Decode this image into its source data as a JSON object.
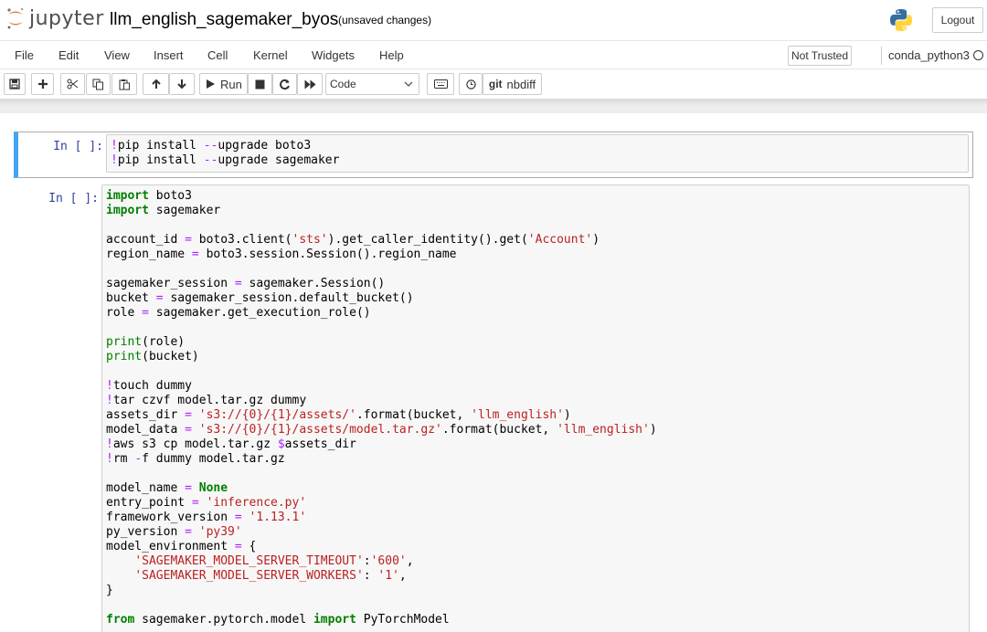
{
  "header": {
    "logo_text": "jupyter",
    "notebook_title": "llm_english_sagemaker_byos",
    "autosave_status": "(unsaved changes)",
    "logout_label": "Logout",
    "colors": {
      "logo_orange": "#f37726",
      "python_blue": "#366f9f",
      "python_yellow": "#ffd43b"
    }
  },
  "menubar": {
    "items": [
      "File",
      "Edit",
      "View",
      "Insert",
      "Cell",
      "Kernel",
      "Widgets",
      "Help"
    ],
    "trust_label": "Not Trusted",
    "kernel_name": "conda_python3"
  },
  "toolbar": {
    "run_label": "Run",
    "cell_type": "Code",
    "nbdiff_label": "nbdiff",
    "icons": [
      "save-icon",
      "plus-icon",
      "cut-icon",
      "copy-icon",
      "paste-icon",
      "arrow-up-icon",
      "arrow-down-icon",
      "play-icon",
      "stop-icon",
      "restart-icon",
      "fast-forward-icon",
      "keyboard-icon",
      "clock-icon",
      "git-icon"
    ]
  },
  "cells": [
    {
      "prompt": "In [ ]:",
      "lines": [
        [
          [
            "op",
            "!"
          ],
          [
            "",
            "pip install "
          ],
          [
            "op",
            "--"
          ],
          [
            "",
            "upgrade boto3"
          ]
        ],
        [
          [
            "op",
            "!"
          ],
          [
            "",
            "pip install "
          ],
          [
            "op",
            "--"
          ],
          [
            "",
            "upgrade sagemaker"
          ]
        ]
      ]
    },
    {
      "prompt": "In [ ]:",
      "lines": [
        [
          [
            "kw",
            "import"
          ],
          [
            "",
            " boto3"
          ]
        ],
        [
          [
            "kw",
            "import"
          ],
          [
            "",
            " sagemaker"
          ]
        ],
        [],
        [
          [
            "",
            "account_id "
          ],
          [
            "op",
            "="
          ],
          [
            "",
            " boto3.client("
          ],
          [
            "st",
            "'sts'"
          ],
          [
            "",
            ").get_caller_identity().get("
          ],
          [
            "st",
            "'Account'"
          ],
          [
            "",
            ")"
          ]
        ],
        [
          [
            "",
            "region_name "
          ],
          [
            "op",
            "="
          ],
          [
            "",
            " boto3.session.Session().region_name"
          ]
        ],
        [],
        [
          [
            "",
            "sagemaker_session "
          ],
          [
            "op",
            "="
          ],
          [
            "",
            " sagemaker.Session()"
          ]
        ],
        [
          [
            "",
            "bucket "
          ],
          [
            "op",
            "="
          ],
          [
            "",
            " sagemaker_session.default_bucket()"
          ]
        ],
        [
          [
            "",
            "role "
          ],
          [
            "op",
            "="
          ],
          [
            "",
            " sagemaker.get_execution_role()"
          ]
        ],
        [],
        [
          [
            "bi",
            "print"
          ],
          [
            "",
            "(role)"
          ]
        ],
        [
          [
            "bi",
            "print"
          ],
          [
            "",
            "(bucket)"
          ]
        ],
        [],
        [
          [
            "op",
            "!"
          ],
          [
            "",
            "touch dummy"
          ]
        ],
        [
          [
            "op",
            "!"
          ],
          [
            "",
            "tar czvf model.tar.gz dummy"
          ]
        ],
        [
          [
            "",
            "assets_dir "
          ],
          [
            "op",
            "="
          ],
          [
            "",
            ""
          ],
          [
            "st",
            " 's3://{0}/{1}/assets/'"
          ],
          [
            "",
            ".format(bucket, "
          ],
          [
            "st",
            "'llm_english'"
          ],
          [
            "",
            ")"
          ]
        ],
        [
          [
            "",
            "model_data "
          ],
          [
            "op",
            "="
          ],
          [
            "st",
            " 's3://{0}/{1}/assets/model.tar.gz'"
          ],
          [
            "",
            ".format(bucket, "
          ],
          [
            "st",
            "'llm_english'"
          ],
          [
            "",
            ")"
          ]
        ],
        [
          [
            "op",
            "!"
          ],
          [
            "",
            "aws s3 cp model.tar.gz "
          ],
          [
            "op",
            "$"
          ],
          [
            "",
            "assets_dir"
          ]
        ],
        [
          [
            "op",
            "!"
          ],
          [
            "",
            "rm "
          ],
          [
            "op",
            "-"
          ],
          [
            "",
            "f dummy model.tar.gz"
          ]
        ],
        [],
        [
          [
            "",
            "model_name "
          ],
          [
            "op",
            "="
          ],
          [
            "",
            " "
          ],
          [
            "kw",
            "None"
          ]
        ],
        [
          [
            "",
            "entry_point "
          ],
          [
            "op",
            "="
          ],
          [
            "st",
            " 'inference.py'"
          ]
        ],
        [
          [
            "",
            "framework_version "
          ],
          [
            "op",
            "="
          ],
          [
            "st",
            " '1.13.1'"
          ]
        ],
        [
          [
            "",
            "py_version "
          ],
          [
            "op",
            "="
          ],
          [
            "st",
            " 'py39'"
          ]
        ],
        [
          [
            "",
            "model_environment "
          ],
          [
            "op",
            "="
          ],
          [
            "",
            " {"
          ]
        ],
        [
          [
            "",
            "    "
          ],
          [
            "st",
            "'SAGEMAKER_MODEL_SERVER_TIMEOUT'"
          ],
          [
            "",
            ":"
          ],
          [
            "st",
            "'600'"
          ],
          [
            "",
            ","
          ]
        ],
        [
          [
            "",
            "    "
          ],
          [
            "st",
            "'SAGEMAKER_MODEL_SERVER_WORKERS'"
          ],
          [
            "",
            ": "
          ],
          [
            "st",
            "'1'"
          ],
          [
            "",
            ","
          ]
        ],
        [
          [
            "",
            "}"
          ]
        ],
        [],
        [
          [
            "kw",
            "from"
          ],
          [
            "",
            " sagemaker.pytorch.model "
          ],
          [
            "kw",
            "import"
          ],
          [
            "",
            " PyTorchModel"
          ]
        ]
      ]
    }
  ]
}
